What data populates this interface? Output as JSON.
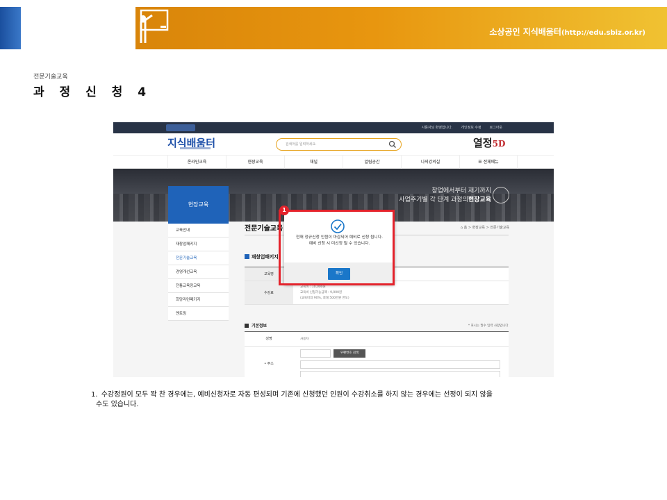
{
  "slide": {
    "site_name": "소상공인 지식배움터",
    "site_url": "(http://edu.sbiz.or.kr)",
    "breadcrumb": "전문기술교육",
    "title": "과 정 신 청 4"
  },
  "screenshot": {
    "topbar_links": [
      "사용자님 환영합니다.",
      "개인정보 수정",
      "로그아웃"
    ],
    "logo": "지식배움터",
    "search_placeholder": "검색어를 입력하세요.",
    "promo_text": "열정",
    "promo_suffix": "5D",
    "gnb": [
      "온라인교육",
      "현장교육",
      "채널",
      "알림공간",
      "나의강의실",
      "전체메뉴"
    ],
    "banner_line1": "창업에서부터 재기까지",
    "banner_line2_pre": "사업주기별 각 단계 과정의",
    "banner_line2_bold": "현장교육",
    "lnb_title": "현장교육",
    "lnb_items": [
      "교육안내",
      "재창업패키지",
      "전문기술교육",
      "경영개선교육",
      "전통교육장교육",
      "희망리턴패키지",
      "멘토링"
    ],
    "lnb_active_index": 2,
    "content_title": "전문기술교육",
    "content_path": "홈 > 현장교육 > 전문기술교육",
    "section1_title": "재창업패키지",
    "table1_rows": [
      {
        "label": "교육명",
        "lines": []
      },
      {
        "label": "수강료",
        "lines": [
          "교육비 : 10,000원",
          "교육비 신청가능금액 : 9,000원",
          "(교육비의 90%, 최대 500만원 한도)"
        ]
      }
    ],
    "section2_title": "기본정보",
    "required_note": "* 표시는 필수 입력 사항입니다.",
    "table2_rows": [
      {
        "label": "성명",
        "value": "사용자"
      },
      {
        "label": "• 주소",
        "value": ""
      }
    ],
    "zip_button": "우편번호 검색",
    "modal": {
      "message_line1": "현재 정규신청 인원이 마감되어 예비로 신청 됩니다.",
      "message_line2": "예비 신청 시 미선정 될 수 있습니다.",
      "ok_label": "확인",
      "accent_color": "#1a77c9"
    }
  },
  "callout_number": "1",
  "notes": {
    "item_number": "1.",
    "text": "수강정원이 모두 꽉 찬 경우에는, 예비신청자로 자동 편성되며 기존에 신청했던 인원이 수강취소를 하지 않는 경우에는 선정이 되지 않을",
    "text_cont": "수도 있습니다."
  }
}
